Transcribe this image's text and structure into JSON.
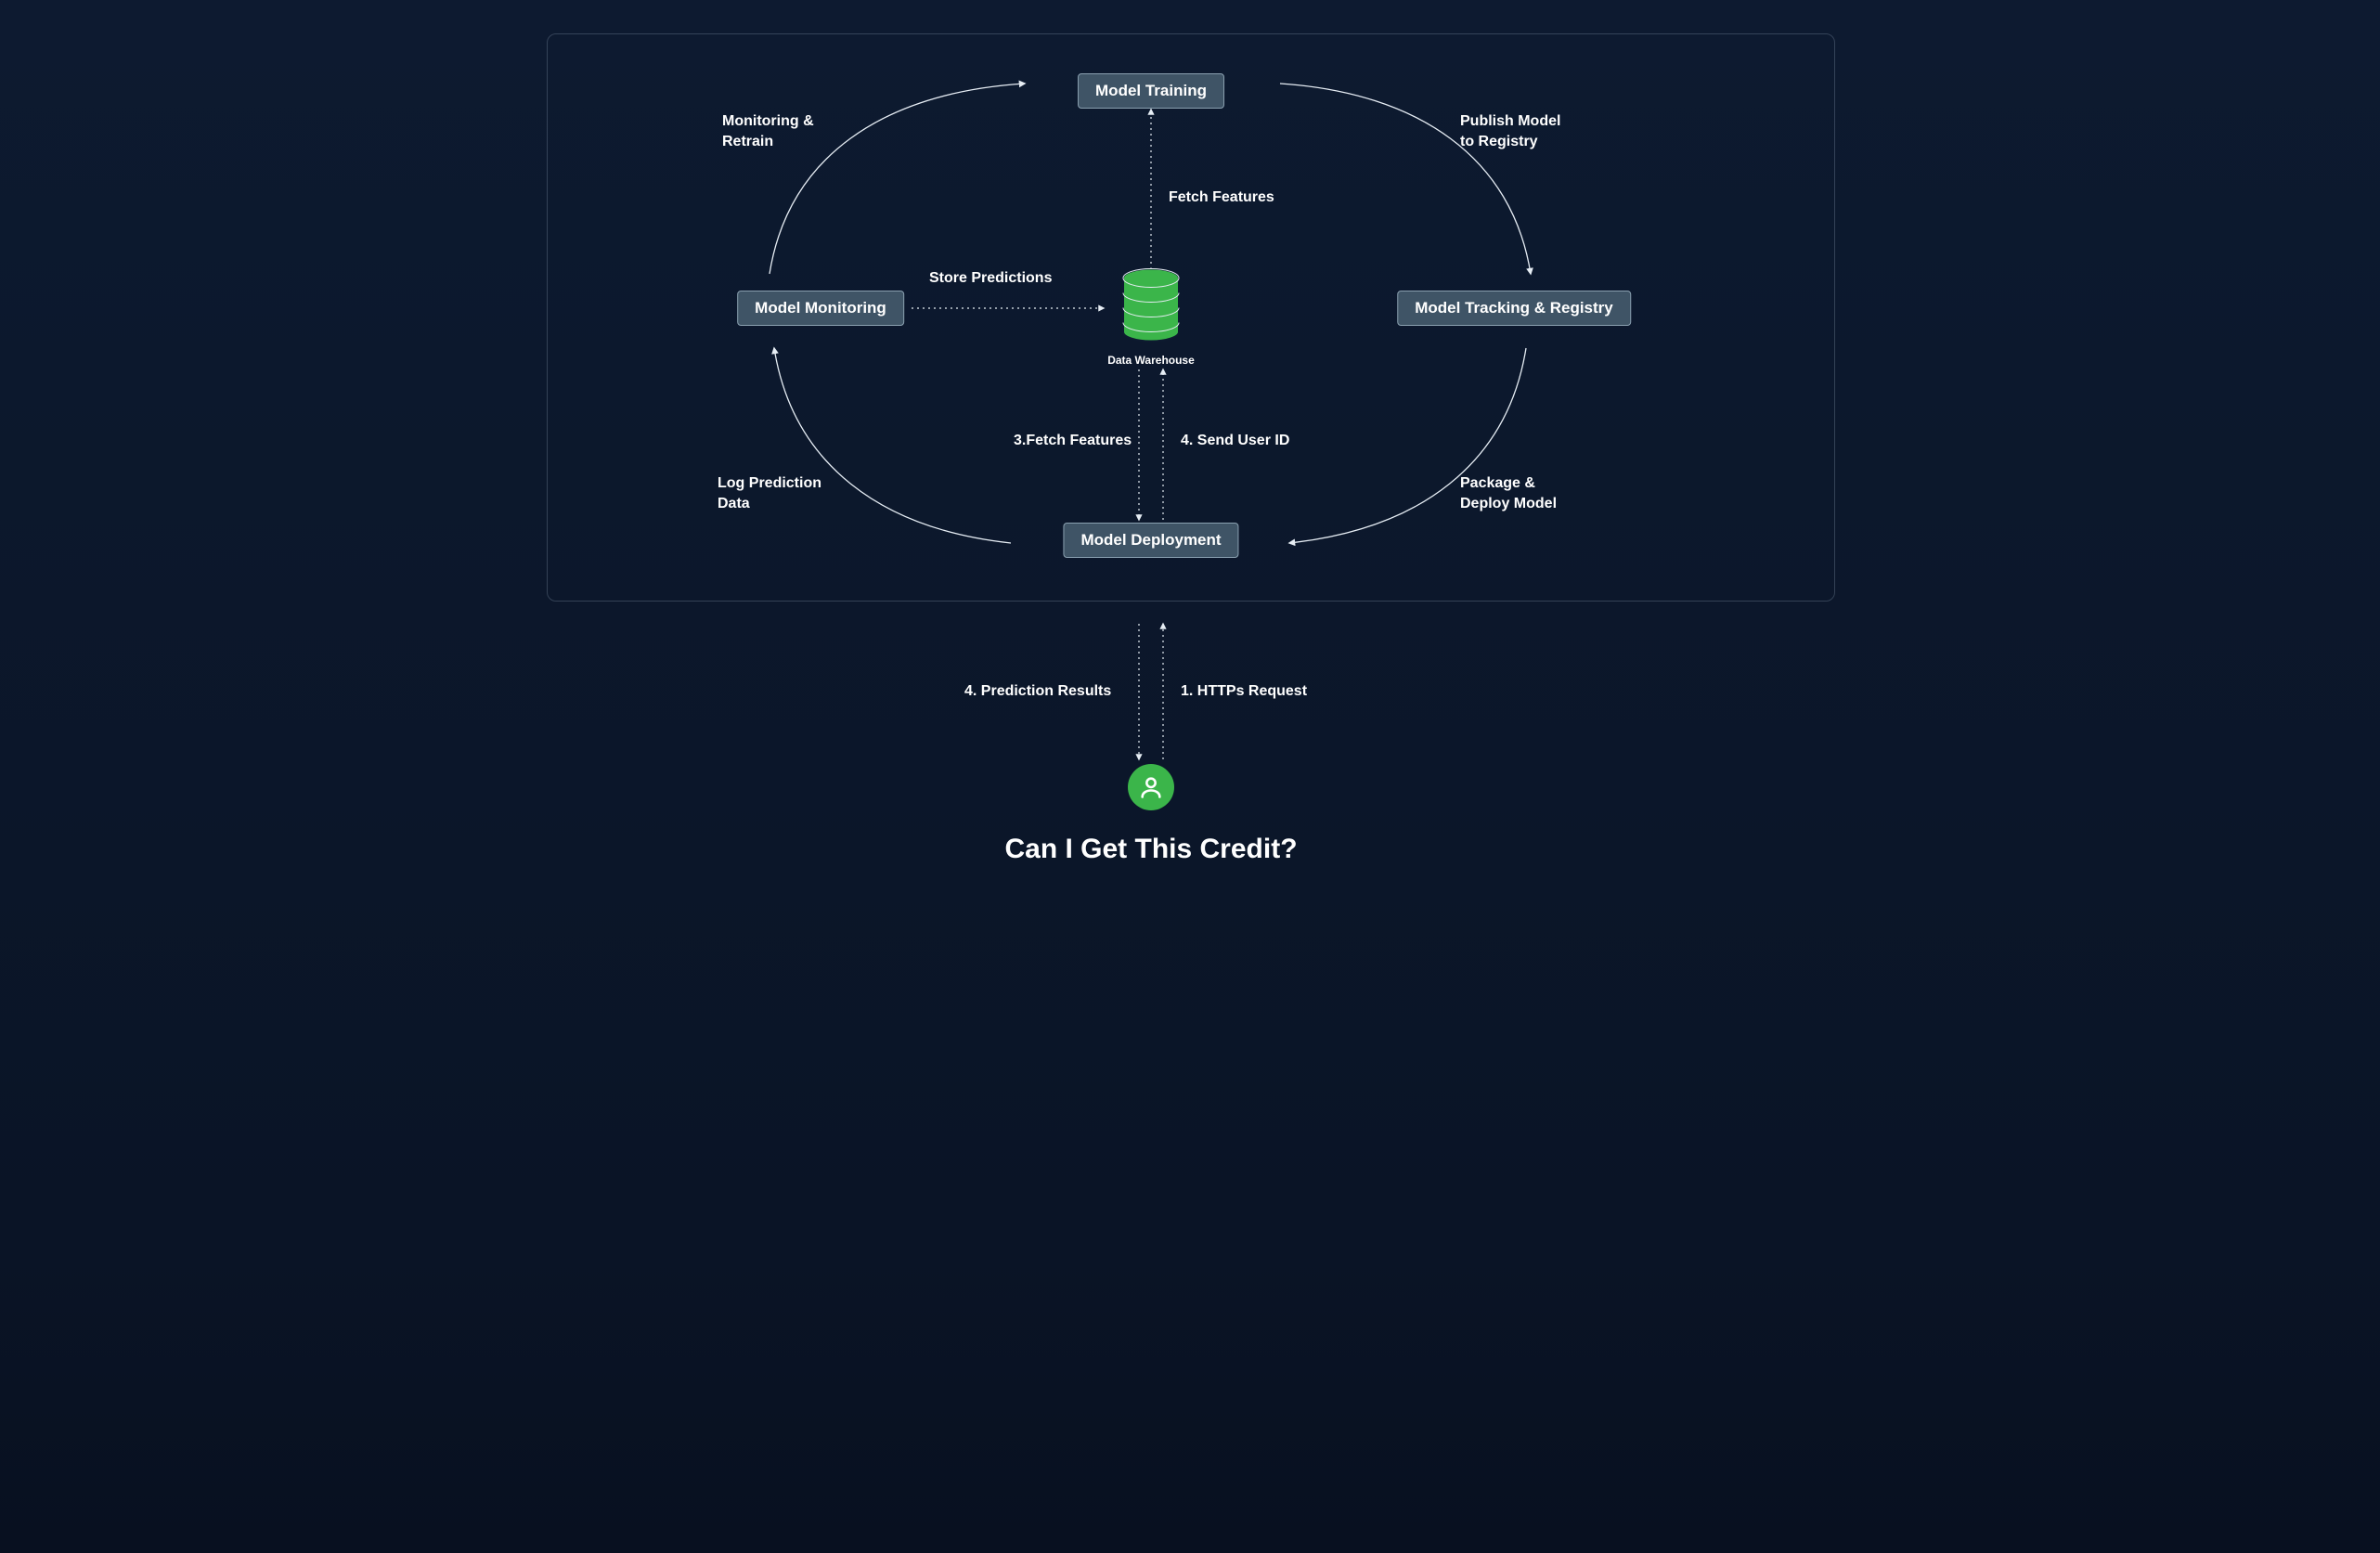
{
  "nodes": {
    "training": "Model Training",
    "registry": "Model Tracking & Registry",
    "deployment": "Model Deployment",
    "monitoring": "Model Monitoring"
  },
  "center": {
    "name": "Data Warehouse"
  },
  "labels": {
    "monitoring_retrain": "Monitoring &\nRetrain",
    "publish": "Publish Model\nto Registry",
    "store_predictions": "Store Predictions",
    "fetch_features": "Fetch Features",
    "fetch_features_3": "3.Fetch Features",
    "send_user_id": "4. Send User ID",
    "log_prediction": "Log Prediction\nData",
    "package_deploy": "Package &\nDeploy Model",
    "prediction_results": "4.  Prediction Results",
    "https_request": "1. HTTPs Request"
  },
  "caption": "Can I Get This Credit?"
}
